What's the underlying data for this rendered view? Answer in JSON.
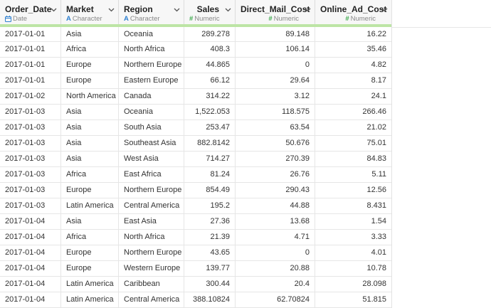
{
  "colors": {
    "date_icon": "#2d7fd0",
    "character_icon": "#2d7fd0",
    "numeric_icon": "#3aa94a",
    "header_underline": "#bde5a5"
  },
  "columns": [
    {
      "name": "Order_Date",
      "type": "Date",
      "icon": "calendar-icon",
      "align": "left"
    },
    {
      "name": "Market",
      "type": "Character",
      "icon": "character-icon",
      "align": "left"
    },
    {
      "name": "Region",
      "type": "Character",
      "icon": "character-icon",
      "align": "left"
    },
    {
      "name": "Sales",
      "type": "Numeric",
      "icon": "numeric-icon",
      "align": "right"
    },
    {
      "name": "Direct_Mail_Cost",
      "type": "Numeric",
      "icon": "numeric-icon",
      "align": "right"
    },
    {
      "name": "Online_Ad_Cost",
      "type": "Numeric",
      "icon": "numeric-icon",
      "align": "right"
    }
  ],
  "rows": [
    [
      "2017-01-01",
      "Asia",
      "Oceania",
      "289.278",
      "89.148",
      "16.22"
    ],
    [
      "2017-01-01",
      "Africa",
      "North Africa",
      "408.3",
      "106.14",
      "35.46"
    ],
    [
      "2017-01-01",
      "Europe",
      "Northern Europe",
      "44.865",
      "0",
      "4.82"
    ],
    [
      "2017-01-01",
      "Europe",
      "Eastern Europe",
      "66.12",
      "29.64",
      "8.17"
    ],
    [
      "2017-01-02",
      "North America",
      "Canada",
      "314.22",
      "3.12",
      "24.1"
    ],
    [
      "2017-01-03",
      "Asia",
      "Oceania",
      "1,522.053",
      "118.575",
      "266.46"
    ],
    [
      "2017-01-03",
      "Asia",
      "South Asia",
      "253.47",
      "63.54",
      "21.02"
    ],
    [
      "2017-01-03",
      "Asia",
      "Southeast Asia",
      "882.8142",
      "50.676",
      "75.01"
    ],
    [
      "2017-01-03",
      "Asia",
      "West Asia",
      "714.27",
      "270.39",
      "84.83"
    ],
    [
      "2017-01-03",
      "Africa",
      "East Africa",
      "81.24",
      "26.76",
      "5.11"
    ],
    [
      "2017-01-03",
      "Europe",
      "Northern Europe",
      "854.49",
      "290.43",
      "12.56"
    ],
    [
      "2017-01-03",
      "Latin America",
      "Central America",
      "195.2",
      "44.88",
      "8.431"
    ],
    [
      "2017-01-04",
      "Asia",
      "East Asia",
      "27.36",
      "13.68",
      "1.54"
    ],
    [
      "2017-01-04",
      "Africa",
      "North Africa",
      "21.39",
      "4.71",
      "3.33"
    ],
    [
      "2017-01-04",
      "Europe",
      "Northern Europe",
      "43.65",
      "0",
      "4.01"
    ],
    [
      "2017-01-04",
      "Europe",
      "Western Europe",
      "139.77",
      "20.88",
      "10.78"
    ],
    [
      "2017-01-04",
      "Latin America",
      "Caribbean",
      "300.44",
      "20.4",
      "28.098"
    ],
    [
      "2017-01-04",
      "Latin America",
      "Central America",
      "388.10824",
      "62.70824",
      "51.815"
    ]
  ]
}
